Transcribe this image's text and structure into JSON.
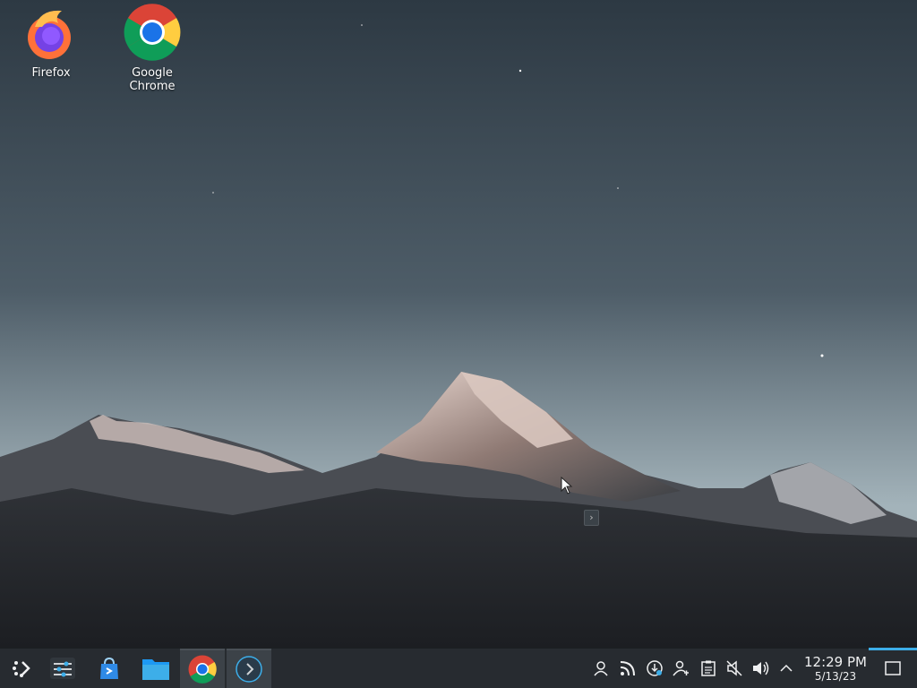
{
  "desktop": {
    "icons": [
      {
        "label": "Firefox",
        "icon": "firefox-icon"
      },
      {
        "label": "Google Chrome",
        "icon": "chrome-icon"
      }
    ]
  },
  "taskbar": {
    "launchers": [
      {
        "name": "application-launcher",
        "icon": "kde-launcher-icon"
      },
      {
        "name": "system-settings",
        "icon": "settings-sliders-icon"
      },
      {
        "name": "discover",
        "icon": "store-bag-icon"
      },
      {
        "name": "file-manager",
        "icon": "folder-icon"
      },
      {
        "name": "google-chrome",
        "icon": "chrome-icon"
      },
      {
        "name": "steam-return",
        "icon": "return-arrow-icon"
      }
    ],
    "tray": [
      "user-icon",
      "rss-icon",
      "update-icon",
      "user-network-icon",
      "clipboard-icon",
      "mic-muted-icon",
      "volume-icon",
      "chevron-up-icon"
    ],
    "clock": {
      "time": "12:29 PM",
      "date": "5/13/23"
    },
    "show_desktop": "show-desktop-icon"
  },
  "colors": {
    "taskbar_bg": "#272b30",
    "accent": "#3daee9",
    "text": "#eff0f1"
  }
}
